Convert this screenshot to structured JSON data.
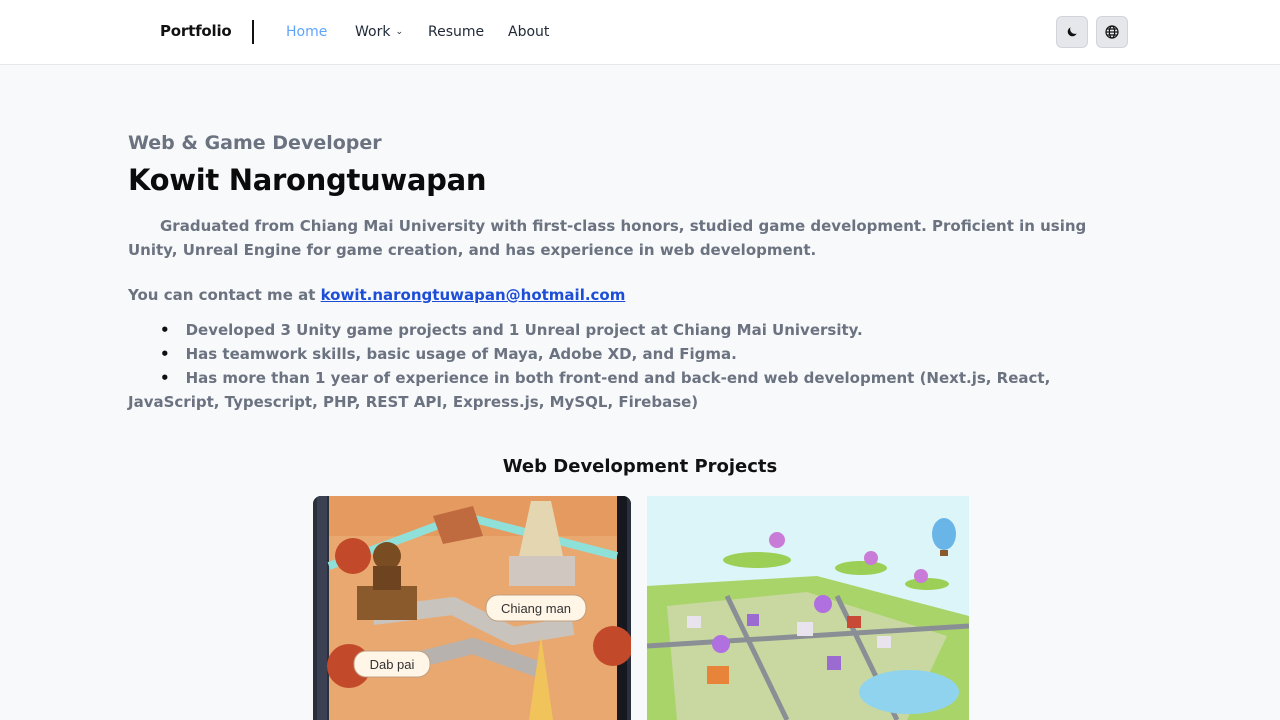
{
  "nav": {
    "brand": "Portfolio",
    "home": "Home",
    "work": "Work",
    "resume": "Resume",
    "about": "About",
    "icons": {
      "theme": "moon-icon",
      "language": "globe-icon"
    },
    "active_color": "#60a5fa"
  },
  "hero": {
    "subtitle": "Web & Game Developer",
    "name": "Kowit Narongtuwapan",
    "bio": "Graduated from Chiang Mai University with first-class honors, studied game development. Proficient in using Unity, Unreal Engine for game creation, and has experience in web development.",
    "contact_prefix": "You can contact me at ",
    "email": "kowit.narongtuwapan@hotmail.com",
    "bullets": [
      "Developed 3 Unity game projects and 1 Unreal project at Chiang Mai University.",
      "Has teamwork skills, basic usage of Maya, Adobe XD, and Figma.",
      "Has more than 1 year of experience in both front-end and back-end web development (Next.js, React, JavaScript, Typescript, PHP, REST API, Express.js, MySQL, Firebase)"
    ]
  },
  "projects": {
    "title": "Web Development Projects",
    "card1_labels": [
      "Chiang man",
      "Dab pai"
    ]
  }
}
